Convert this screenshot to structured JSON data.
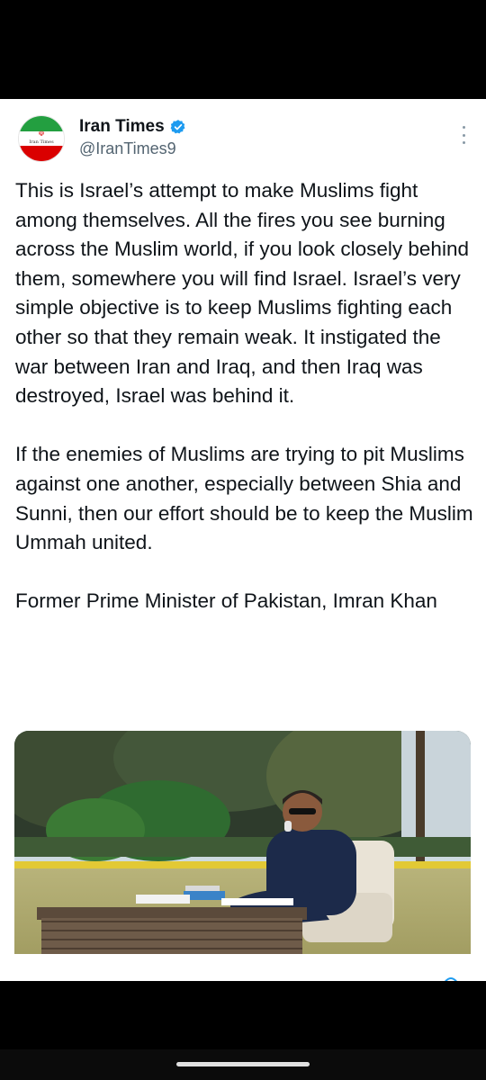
{
  "tweet": {
    "author": {
      "display_name": "Iran Times",
      "handle": "@IranTimes9",
      "verified": true,
      "avatar_text": "Iran Times"
    },
    "paragraphs": [
      "This is Israel’s attempt to make Muslims fight among themselves. All the fires you see burning across the Muslim world, if you look closely behind them, somewhere you will find Israel. Israel’s very simple objective is to keep Muslims fighting each other so that they remain weak. It instigated the war between Iran and Iraq, and then Iraq was destroyed, Israel was behind it.",
      "If the enemies of Muslims are trying to pit Muslims against one another, especially between Shia and Sunni, then our effort should be to keep the Muslim Ummah united.",
      "Former Prime Minister of Pakistan, Imran Khan"
    ],
    "more_icon": "more-vertical-icon",
    "media_alt": "photo of a man in sunglasses on a phone, seated in an armchair outdoors beside a wicker table"
  },
  "colors": {
    "text": "#0f1419",
    "secondary": "#536471",
    "verified": "#1d9bf0"
  }
}
